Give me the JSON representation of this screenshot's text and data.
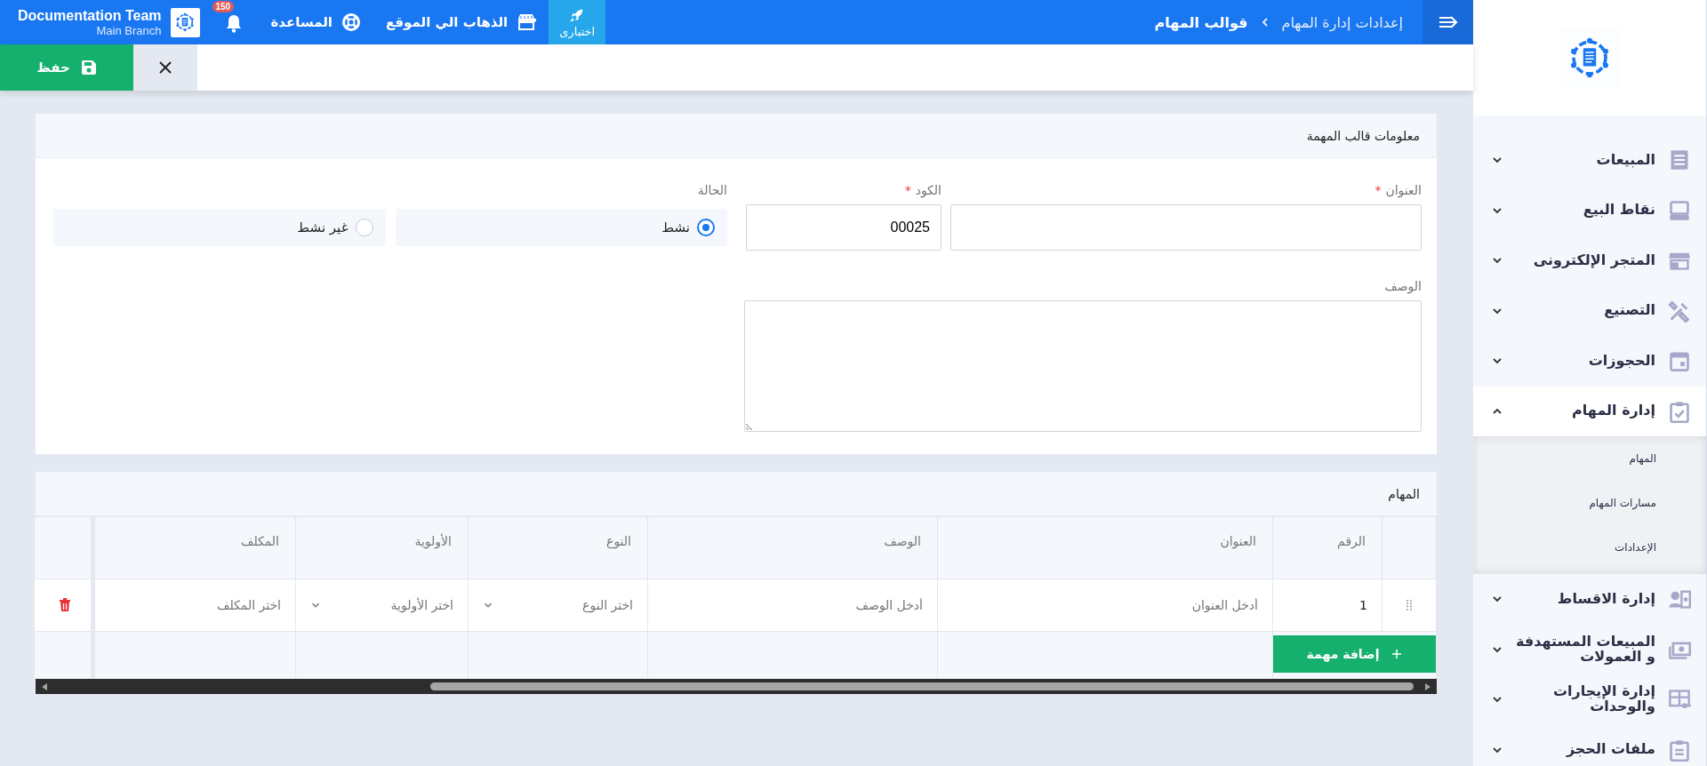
{
  "topbar": {
    "breadcrumb": [
      {
        "label": "إعدادات إدارة المهام",
        "current": false
      },
      {
        "label": "قوالب المهام",
        "current": true
      }
    ],
    "test_badge": "اختبارى",
    "links": [
      {
        "label": "الذهاب الي الموقع"
      },
      {
        "label": "المساعدة"
      }
    ],
    "notifications": "150",
    "user": {
      "name": "Documentation Team",
      "branch": "Main Branch"
    }
  },
  "toolbar": {
    "save": "حفظ"
  },
  "info_card": {
    "title": "معلومات قالب المهمة",
    "title_field": {
      "label": "العنوان",
      "required_mark": "*"
    },
    "code_field": {
      "label": "الكود",
      "required_mark": "*",
      "value": "00025"
    },
    "status": {
      "label": "الحالة",
      "options": [
        {
          "label": "نشط",
          "selected": true
        },
        {
          "label": "غير نشط",
          "selected": false
        }
      ]
    },
    "description": {
      "label": "الوصف"
    }
  },
  "tasks": {
    "title": "المهام",
    "columns": [
      "الرقم",
      "العنوان",
      "الوصف",
      "النوع",
      "الأولوية",
      "المكلف"
    ],
    "rows": [
      {
        "number": "1",
        "title_placeholder": "أدخل العنوان",
        "description_placeholder": "أدخل الوصف",
        "type_placeholder": "اختر النوع",
        "priority_placeholder": "اختر الأولوية",
        "assignee_placeholder": "اختر المكلف"
      }
    ],
    "add_button": "إضافة مهمة"
  },
  "sidebar": {
    "items": [
      {
        "label": "المبيعات",
        "expanded": false
      },
      {
        "label": "نقاط البيع",
        "expanded": false
      },
      {
        "label": "المتجر الإلكترونى",
        "expanded": false
      },
      {
        "label": "التصنيع",
        "expanded": false
      },
      {
        "label": "الحجوزات",
        "expanded": false
      },
      {
        "label": "إدارة المهام",
        "expanded": true,
        "children": [
          {
            "label": "المهام"
          },
          {
            "label": "مسارات المهام"
          },
          {
            "label": "الإعدادات"
          }
        ]
      },
      {
        "label": "إدارة الاقساط",
        "expanded": false
      },
      {
        "label": "المبيعات المستهدفة و العمولات",
        "expanded": false
      },
      {
        "label": "إدارة الإيجارات والوحدات",
        "expanded": false
      },
      {
        "label": "ملفات الحجز",
        "expanded": false
      }
    ]
  }
}
